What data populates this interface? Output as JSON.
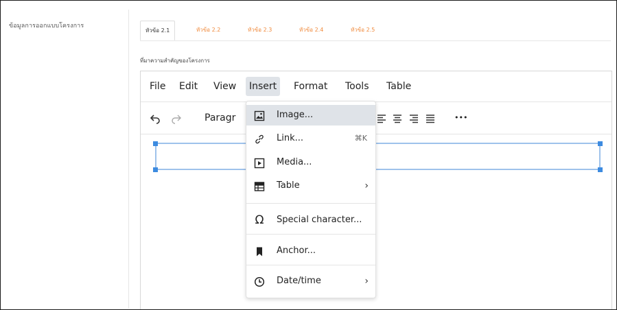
{
  "sidebar": {
    "label": "ข้อมูลการออกแบบโครงการ"
  },
  "tabs": [
    {
      "label": "หัวข้อ 2.1",
      "active": true
    },
    {
      "label": "หัวข้อ 2.2"
    },
    {
      "label": "หัวข้อ 2.3"
    },
    {
      "label": "หัวข้อ 2.4"
    },
    {
      "label": "หัวข้อ 2.5"
    }
  ],
  "section": {
    "label": "ที่มาความสำคัญของโครงการ"
  },
  "menubar": {
    "items": [
      "File",
      "Edit",
      "View",
      "Insert",
      "Format",
      "Tools",
      "Table"
    ],
    "active": "Insert"
  },
  "toolbar": {
    "undo_icon": "undo-icon",
    "redo_icon": "redo-icon",
    "block_format": "Paragr",
    "more_label": "•••"
  },
  "insert_menu": {
    "items": [
      {
        "label": "Image...",
        "icon": "image-icon",
        "hover": true
      },
      {
        "label": "Link...",
        "icon": "link-icon",
        "shortcut": "⌘K"
      },
      {
        "label": "Media...",
        "icon": "media-icon"
      },
      {
        "label": "Table",
        "icon": "table-icon",
        "submenu": true
      },
      {
        "label": "Special character...",
        "icon": "omega-icon"
      },
      {
        "label": "Anchor...",
        "icon": "bookmark-icon"
      },
      {
        "label": "Date/time",
        "icon": "clock-icon",
        "submenu": true
      }
    ],
    "submenu_arrow": "›"
  },
  "colors": {
    "tab_text": "#f08a3c",
    "menu_hover": "#dfe3e8",
    "selection_border": "#9ec2eb",
    "selection_handle": "#3d8be0"
  }
}
